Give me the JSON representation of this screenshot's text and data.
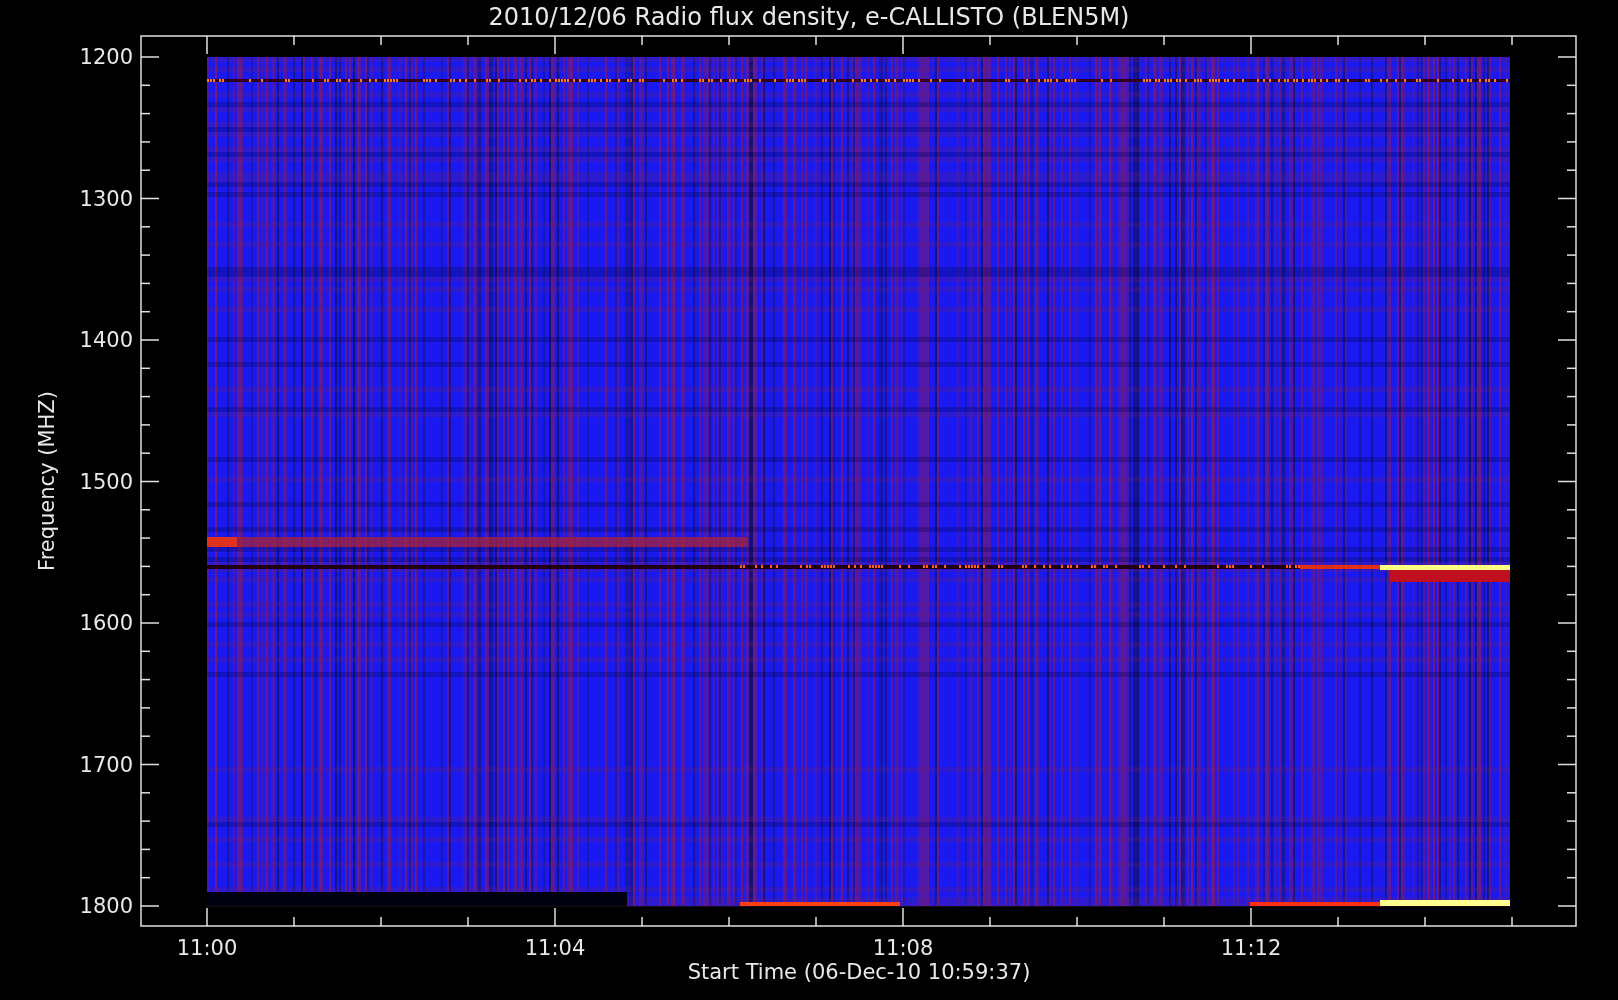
{
  "title": "2010/12/06  Radio flux density, e-CALLISTO (BLEN5M)",
  "y_axis": {
    "label": "Frequency (MHZ)",
    "ticks": [
      "1200",
      "1300",
      "1400",
      "1500",
      "1600",
      "1700",
      "1800"
    ]
  },
  "x_axis": {
    "label": "Start Time (06-Dec-10 10:59:37)",
    "ticks": [
      "11:00",
      "11:04",
      "11:08",
      "11:12"
    ]
  }
}
